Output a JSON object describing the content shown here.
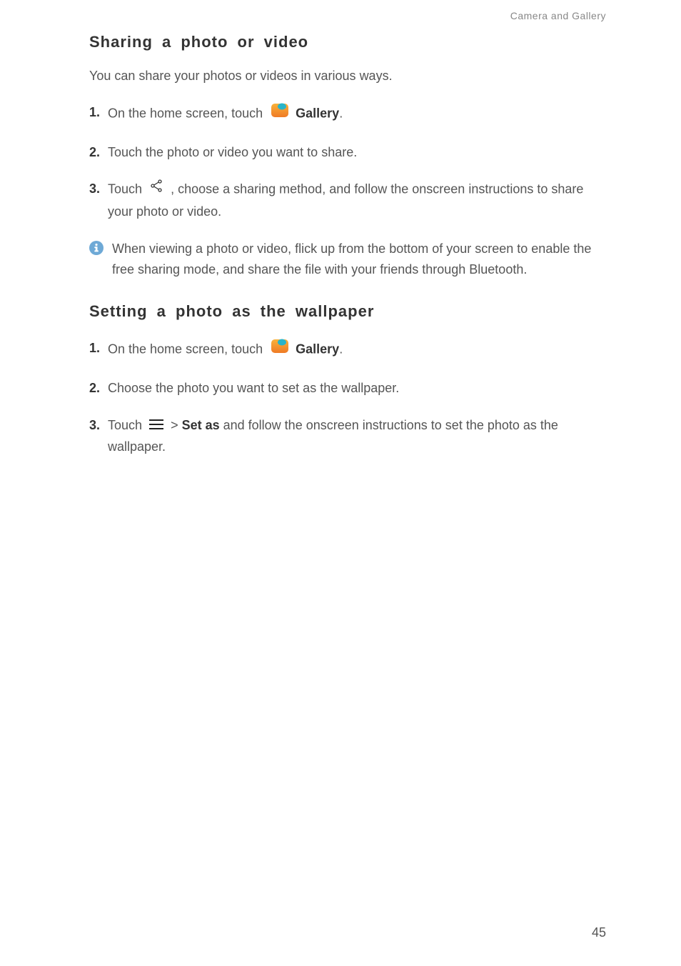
{
  "header": {
    "category": "Camera and Gallery"
  },
  "section1": {
    "title": "Sharing a photo or video",
    "intro": "You can share your photos or videos in various ways.",
    "steps": [
      {
        "num": "1.",
        "pre": "On the home screen, touch ",
        "bold": "Gallery",
        "post": "."
      },
      {
        "num": "2.",
        "text": "Touch the photo or video you want to share."
      },
      {
        "num": "3.",
        "pre": "Touch ",
        "post": ", choose a sharing method, and follow the onscreen instructions to share your photo or video."
      }
    ],
    "info": "When viewing a photo or video, flick up from the bottom of your screen to enable the free sharing mode, and share the file with your friends through Bluetooth."
  },
  "section2": {
    "title": "Setting a photo as the wallpaper",
    "steps": [
      {
        "num": "1.",
        "pre": "On the home screen, touch ",
        "bold": "Gallery",
        "post": "."
      },
      {
        "num": "2.",
        "text": "Choose the photo you want to set as the wallpaper."
      },
      {
        "num": "3.",
        "pre": "Touch ",
        "gt": " > ",
        "bold": "Set as",
        "post": " and follow the onscreen instructions to set the photo as the wallpaper."
      }
    ]
  },
  "pageNumber": "45"
}
